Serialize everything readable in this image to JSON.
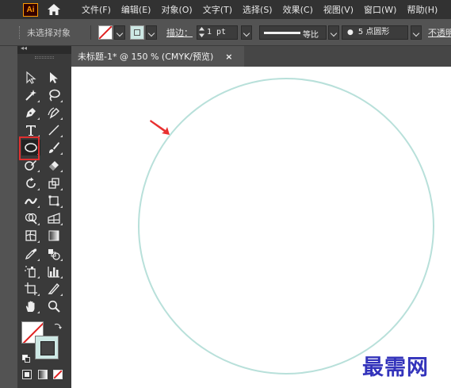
{
  "app": {
    "logo_text": "Ai",
    "brand_color": "#ff9a00"
  },
  "menu": {
    "items": [
      "文件(F)",
      "编辑(E)",
      "对象(O)",
      "文字(T)",
      "选择(S)",
      "效果(C)",
      "视图(V)",
      "窗口(W)",
      "帮助(H)"
    ]
  },
  "control_bar": {
    "selection_status": "未选择对象",
    "stroke_label": "描边：",
    "stroke_weight": "1 pt",
    "stroke_profile_label": "等比",
    "brush_definition": "5 点圆形",
    "opacity_label": "不透明"
  },
  "document": {
    "tab_title": "未标题-1* @ 150 % (CMYK/预览)",
    "close_glyph": "×"
  },
  "artwork": {
    "shape": "circle",
    "stroke_color": "#b8e0da",
    "annotation_arrow_color": "#e83030"
  },
  "tools": {
    "selected": "ellipse-tool",
    "highlight_color": "#e03030"
  },
  "colors": {
    "fill": "none",
    "stroke": "#cde8e4"
  },
  "watermark": "最需网"
}
